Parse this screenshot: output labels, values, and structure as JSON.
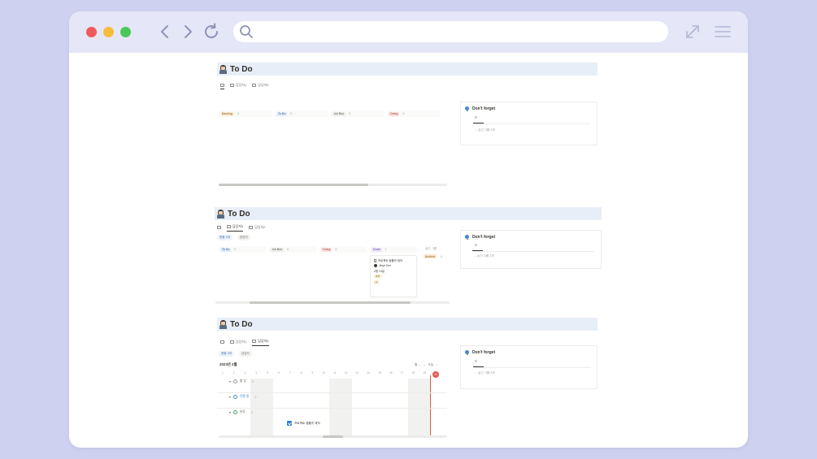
{
  "window": {
    "controls": {
      "close_color": "#f05a5a",
      "minimize_color": "#f6bd3b",
      "maximize_color": "#49c85a"
    },
    "address_bar": {
      "placeholder": ""
    },
    "icons": [
      "chevron-left-icon",
      "chevron-right-icon",
      "reload-icon",
      "search-icon",
      "expand-icon",
      "menu-icon"
    ]
  },
  "sections": [
    {
      "title": "To Do",
      "tabs": [
        {
          "label": ""
        },
        {
          "label": "담당자1"
        },
        {
          "label": "담당자2"
        }
      ],
      "columns": [
        {
          "label": "Backlog",
          "count": "0"
        },
        {
          "label": "To Do",
          "count": "0"
        },
        {
          "label": "Ice Box",
          "count": "0"
        },
        {
          "label": "Doing",
          "count": "0"
        }
      ],
      "side": {
        "title": "Don't forget",
        "hidden": "숨긴 그룹 3개"
      }
    },
    {
      "title": "To Do",
      "tabs": [
        {
          "label": ""
        },
        {
          "label": "담당자1"
        },
        {
          "label": "담당자2"
        }
      ],
      "filters": [
        "현황 3개",
        "담당자"
      ],
      "columns": [
        {
          "label": "To Do",
          "count": "0"
        },
        {
          "label": "Ice Box",
          "count": "0"
        },
        {
          "label": "Doing",
          "count": "0"
        },
        {
          "label": "Done",
          "count": "1"
        }
      ],
      "hidden_group": {
        "title": "숨긴 그룹",
        "label": "Archive",
        "count": "0"
      },
      "card": {
        "title": "프로젝트 템플릿 제작",
        "person": "Jihye Kim",
        "date": "2월 14일",
        "tag1": "제작",
        "tag2": "A"
      },
      "side": {
        "title": "Don't forget",
        "hidden": "숨긴 그룹 3개"
      }
    },
    {
      "title": "To Do",
      "tabs": [
        {
          "label": ""
        },
        {
          "label": "담당자1"
        },
        {
          "label": "담당자2"
        }
      ],
      "filters": [
        "현황 3개",
        "담당자"
      ],
      "timeline": {
        "month": "2023년 2월",
        "controls": {
          "view": "월",
          "today": "오늘"
        },
        "days": [
          "1",
          "2",
          "3",
          "4",
          "5",
          "6",
          "7",
          "8",
          "9",
          "10",
          "11",
          "12",
          "13",
          "14",
          "15",
          "16",
          "17",
          "18",
          "19",
          "20"
        ],
        "today_day": "20",
        "groups": [
          {
            "label": "할 일",
            "count": "0"
          },
          {
            "label": "진행 중",
            "count": "0"
          },
          {
            "label": "완료",
            "count": "2"
          }
        ],
        "item": {
          "title": "프로젝트 템플릿 제작"
        }
      },
      "side": {
        "title": "Don't forget",
        "hidden": "숨긴 그룹 3개"
      }
    }
  ]
}
